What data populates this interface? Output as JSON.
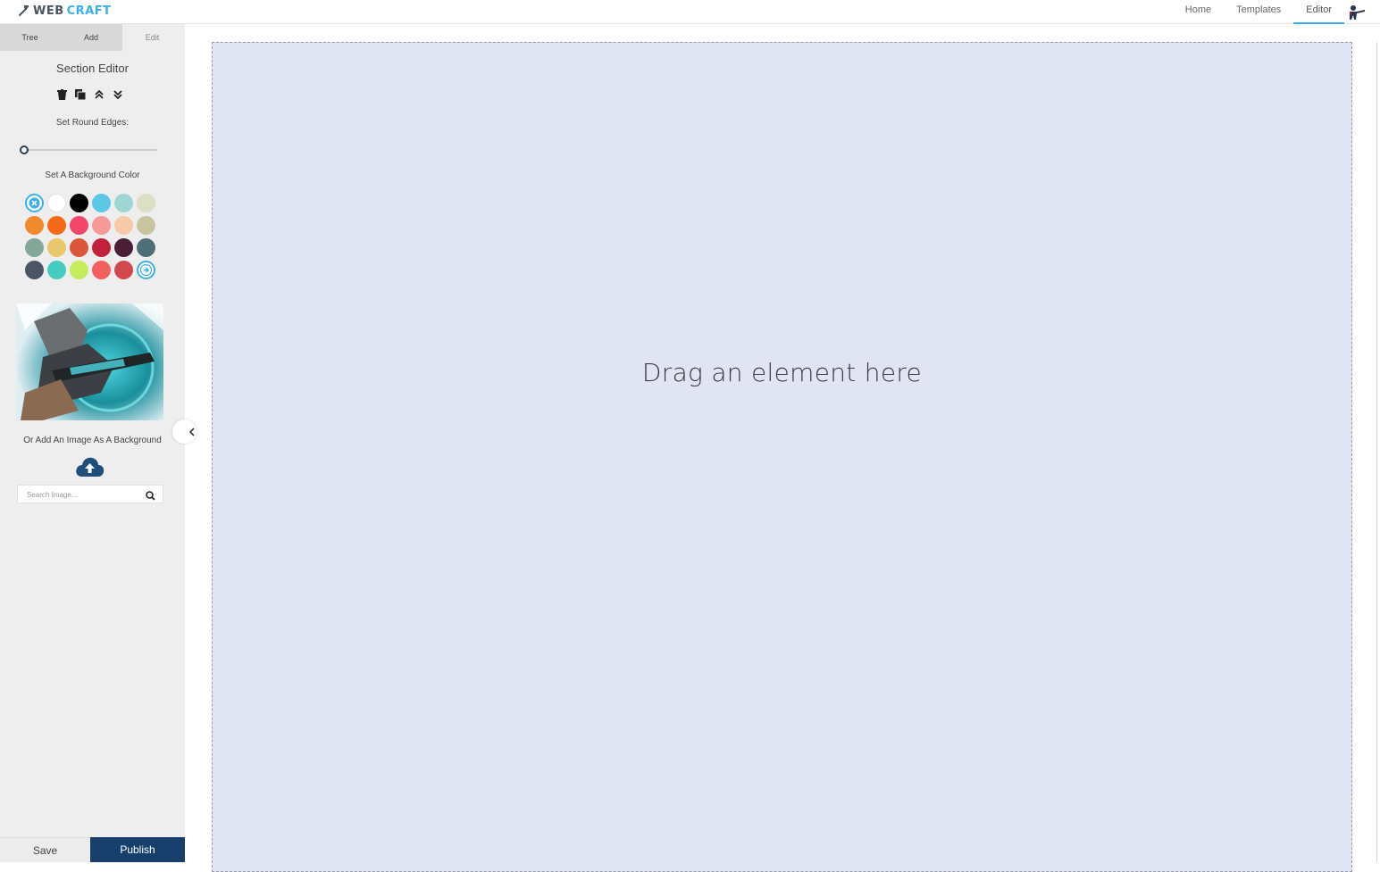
{
  "app": {
    "logo_part1": "WEB",
    "logo_part2": "CRAFT"
  },
  "nav": {
    "links": [
      {
        "label": "Home",
        "active": false
      },
      {
        "label": "Templates",
        "active": false
      },
      {
        "label": "Editor",
        "active": true
      }
    ]
  },
  "sidebar": {
    "tabs": [
      {
        "label": "Tree",
        "active": false
      },
      {
        "label": "Add",
        "active": false
      },
      {
        "label": "Edit",
        "active": true
      }
    ],
    "section_title": "Section Editor",
    "tools": [
      "trash-icon",
      "copy-icon",
      "move-up-icon",
      "move-down-icon"
    ],
    "round_edges_label": "Set Round Edges:",
    "round_edges_value": 0,
    "bg_color_label": "Set A Background Color",
    "colors": [
      "#ffffff",
      "#000000",
      "#5bc8e8",
      "#9dd6d4",
      "#dcdfc4",
      "#ef8a2e",
      "#f46a16",
      "#f2476b",
      "#f59a98",
      "#f7c9a6",
      "#c9c4a0",
      "#83a89a",
      "#e8c86a",
      "#d9583c",
      "#c1213c",
      "#4a1f35",
      "#4e6e78",
      "#4a5666",
      "#46cbc0",
      "#c5ec5a",
      "#f25f5e",
      "#d3484d"
    ],
    "bg_image_label": "Or Add An Image As A Background",
    "search_placeholder": "Search Image..."
  },
  "footer": {
    "save_label": "Save",
    "publish_label": "Publish"
  },
  "canvas": {
    "placeholder": "Drag an element here"
  }
}
